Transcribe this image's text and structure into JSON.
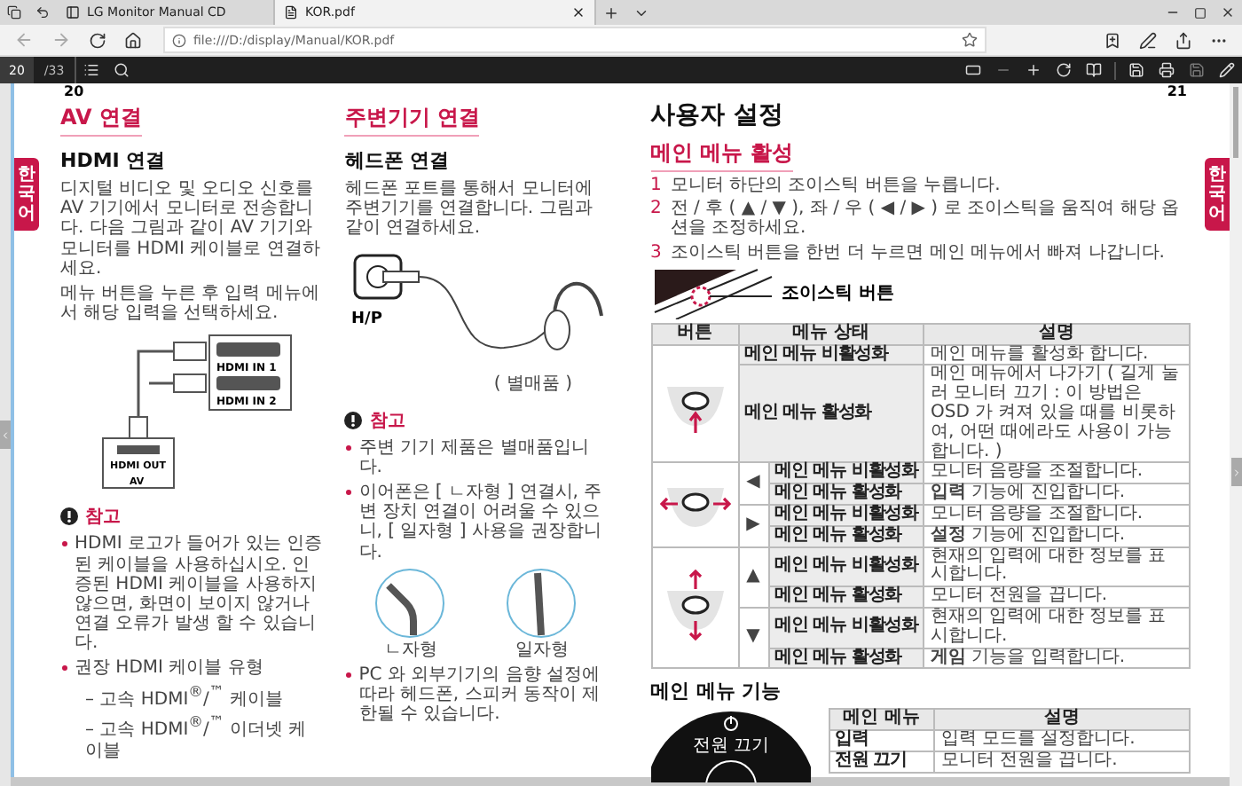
{
  "browser": {
    "tabs": [
      {
        "title": "LG Monitor Manual CD",
        "selected": false
      },
      {
        "title": "KOR.pdf",
        "selected": true
      }
    ],
    "address": "file:///D:/display/Manual/KOR.pdf"
  },
  "pdf_toolbar": {
    "page": "20",
    "page_count": "/33"
  },
  "left_page": {
    "number": "20",
    "side_tab": "한국어",
    "av": {
      "title": "AV 연결",
      "subtitle": "HDMI 연결",
      "paragraphs": [
        "디지털 비디오 및 오디오 신호를 AV 기기에서 모니터로 전송합니다. 다음 그림과 같이 AV 기기와 모니터를 HDMI 케이블로 연결하세요.",
        "메뉴 버튼을 누른 후 입력 메뉴에서 해당 입력을 선택하세요."
      ],
      "diagram_labels": {
        "input_1": "HDMI IN 1",
        "input_2": "HDMI IN 2",
        "output": "HDMI OUT",
        "device": "AV"
      },
      "note": {
        "title": "참고",
        "items": [
          {
            "text": "HDMI 로고가 들어가 있는 인증된 케이블을 사용하십시오. 인증된 HDMI 케이블을 사용하지 않으면, 화면이 보이지 않거나 연결 오류가 발생 할 수 있습니다."
          },
          {
            "text": "권장 HDMI 케이블 유형",
            "children": [
              {
                "text": "– 고속 HDMI$^{®}$/$^{™}$ 케이블"
              },
              {
                "text": "– 고속 HDMI$^{®}$/$^{™}$ 이더넷 케이블"
              }
            ]
          }
        ]
      }
    },
    "peripheral": {
      "title": "주변기기 연결",
      "subtitle": "헤드폰 연결",
      "paragraph": "헤드폰 포트를 통해서 모니터에 주변기기를 연결합니다. 그림과 같이 연결하세요.",
      "port_label": "H/P",
      "caption": "( 별매품 )",
      "note": {
        "title": "참고",
        "items": [
          {
            "text": "주변 기기 제품은 별매품입니다."
          },
          {
            "text": "이어폰은 [ ㄴ자형 ] 연결시, 주변 장치 연결이 어려울 수 있으니, [ 일자형 ] 사용을 권장합니다."
          }
        ]
      },
      "jacks": [
        {
          "label": "ㄴ자형",
          "kind": "bent"
        },
        {
          "label": "일자형",
          "kind": "straight"
        }
      ],
      "after_items": [
        {
          "text": "PC 와 외부기기의 음향 설정에 따라 헤드폰, 스피커 동작이 제한될 수 있습니다."
        }
      ]
    }
  },
  "right_page": {
    "number": "21",
    "side_tab": "한국어",
    "title": "사용자 설정",
    "subtitle": "메인 메뉴 활성",
    "steps": [
      {
        "number": "1",
        "text": "모니터 하단의 조이스틱 버튼을 누릅니다."
      },
      {
        "number": "2",
        "text": "전 / 후 ( ▲ / ▼ ), 좌 / 우 ( ◀ / ▶ ) 로 조이스틱을 움직여 해당 옵션을 조정하세요."
      },
      {
        "number": "3",
        "text": "조이스틱 버튼을 한번 더 누르면 메인 메뉴에서 빠져 나갑니다."
      }
    ],
    "joystick_label": "조이스틱 버튼",
    "table": {
      "columns": [
        "버튼",
        "메뉴 상태",
        "설명"
      ],
      "groups": [
        {
          "kind": "press",
          "subgroups": [
            {
              "rows": [
                {
                  "state": "메인 메뉴 비활성화",
                  "description": "메인 메뉴를 활성화 합니다."
                },
                {
                  "state": "메인 메뉴 활성화",
                  "description": "메인 메뉴에서 나가기 ( 길게 눌러 모니터 끄기 : 이 방법은 OSD 가 켜져 있을 때를 비롯하여, 어떤 때에라도 사용이 가능합니다. )"
                }
              ]
            }
          ]
        },
        {
          "kind": "horizontal",
          "subgroups": [
            {
              "arrow": "◀",
              "rows": [
                {
                  "state": "메인 메뉴 비활성화",
                  "description": "모니터 음량을 조절합니다."
                },
                {
                  "state": "메인 메뉴 활성화",
                  "description": "**입력** 기능에 진입합니다."
                }
              ]
            },
            {
              "arrow": "▶",
              "rows": [
                {
                  "state": "메인 메뉴 비활성화",
                  "description": "모니터 음량을 조절합니다."
                },
                {
                  "state": "메인 메뉴 활성화",
                  "description": "**설정** 기능에 진입합니다."
                }
              ]
            }
          ]
        },
        {
          "kind": "vertical",
          "subgroups": [
            {
              "arrow": "▲",
              "rows": [
                {
                  "state": "메인 메뉴 비활성화",
                  "description": "현재의 입력에 대한 정보를 표시합니다."
                },
                {
                  "state": "메인 메뉴 활성화",
                  "description": "모니터 전원을 끕니다."
                }
              ]
            },
            {
              "arrow": "▼",
              "rows": [
                {
                  "state": "메인 메뉴 비활성화",
                  "description": "현재의 입력에 대한 정보를 표시합니다."
                },
                {
                  "state": "메인 메뉴 활성화",
                  "description": "**게임** 기능을 입력합니다."
                }
              ]
            }
          ]
        }
      ]
    },
    "functions_title": "메인 메뉴 기능",
    "menu_label": "전원 끄기",
    "functions_table": {
      "columns": [
        "메인 메뉴",
        "설명"
      ],
      "rows": [
        {
          "menu": "입력",
          "description": "입력 모드를 설정합니다."
        },
        {
          "menu": "전원 끄기",
          "description": "모니터 전원을 끕니다."
        }
      ]
    }
  }
}
